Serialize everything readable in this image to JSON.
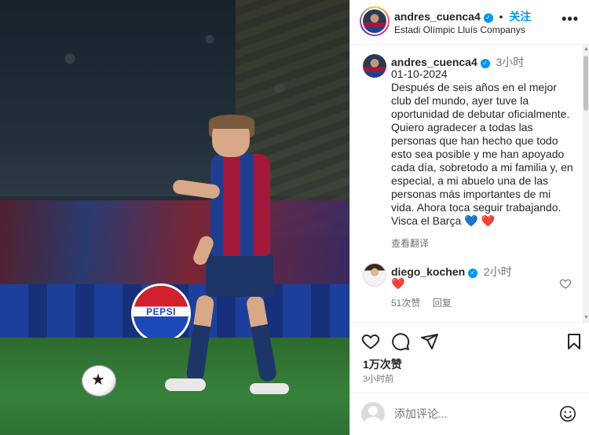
{
  "post": {
    "header": {
      "username": "andres_cuenca4",
      "follow_label": "关注",
      "separator": "•",
      "location": "Estadi Olímpic Lluís Companys"
    },
    "photo": {
      "ad_text": "PEPSI"
    },
    "caption": {
      "username": "andres_cuenca4",
      "time": "3小时",
      "text": "01-10-2024\nDespués de seis años en el mejor club del mundo, ayer tuve la oportunidad de debutar oficialmente.\nQuiero agradecer a todas las personas que han hecho que todo esto sea posible y me han apoyado cada día, sobretodo a mi familia y, en especial, a mi abuelo una de las personas más importantes de mi vida. Ahora toca seguir trabajando.\nVisca el Barça 💙 ❤️",
      "translate_label": "查看翻译"
    },
    "comments": [
      {
        "username": "diego_kochen",
        "time": "2小时",
        "text": "❤️",
        "likes": "51次赞",
        "reply_label": "回复"
      }
    ],
    "actions": {
      "likes_count": "1万次赞",
      "posted_time": "3小时前"
    },
    "comment_input": {
      "placeholder": "添加评论..."
    }
  },
  "icons": {
    "more": "more-horizontal-icon",
    "like": "heart-icon",
    "comment": "comment-bubble-icon",
    "share": "paper-plane-icon",
    "save": "bookmark-icon",
    "emoji": "smiley-icon",
    "verified": "verified-badge-icon"
  },
  "colors": {
    "link_blue": "#0095f6",
    "secondary_text": "#737373",
    "like_red": "#ed4956"
  }
}
